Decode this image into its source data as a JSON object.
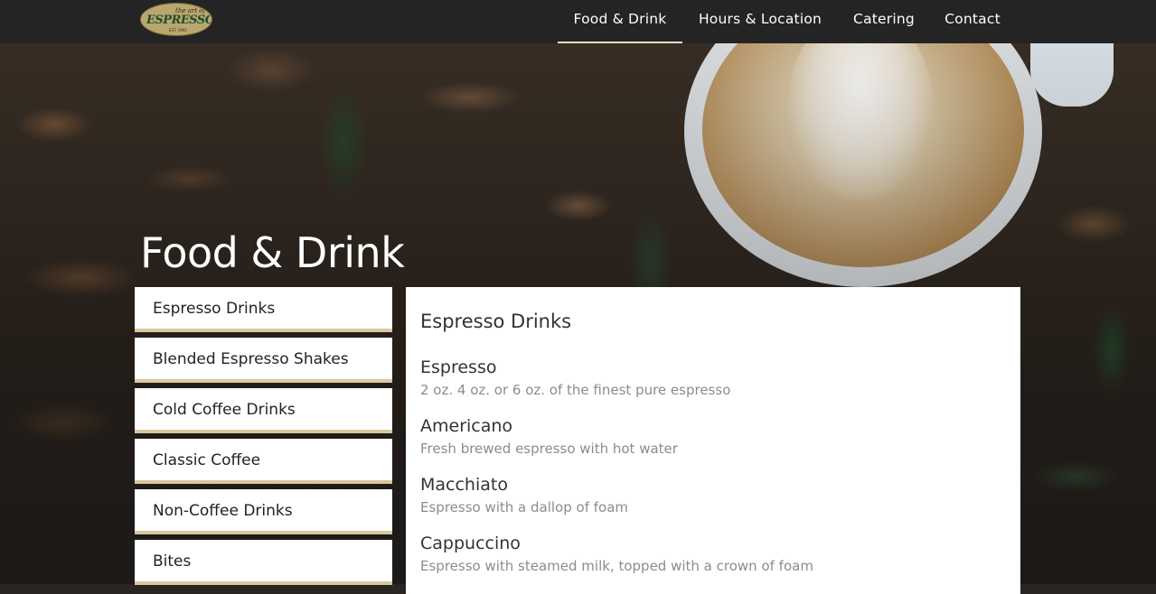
{
  "header": {
    "logo": {
      "small_text": "the art of",
      "main_text": "ESPRESSO",
      "est_text": "EST. 1995"
    },
    "nav": [
      {
        "label": "Food & Drink",
        "active": true
      },
      {
        "label": "Hours & Location",
        "active": false
      },
      {
        "label": "Catering",
        "active": false
      },
      {
        "label": "Contact",
        "active": false
      }
    ]
  },
  "hero": {
    "title": "Food & Drink"
  },
  "side_menu": {
    "items": [
      "Espresso Drinks",
      "Blended Espresso Shakes",
      "Cold Coffee Drinks",
      "Classic Coffee",
      "Non-Coffee Drinks",
      "Bites"
    ]
  },
  "panel": {
    "title": "Espresso Drinks",
    "items": [
      {
        "name": "Espresso",
        "desc": "2 oz. 4 oz. or 6 oz. of the finest pure espresso"
      },
      {
        "name": "Americano",
        "desc": "Fresh brewed espresso with hot water"
      },
      {
        "name": "Macchiato",
        "desc": "Espresso with a dallop of foam"
      },
      {
        "name": "Cappuccino",
        "desc": "Espresso with steamed milk, topped with a crown of foam"
      }
    ]
  },
  "colors": {
    "header_bg": "#242424",
    "active_underline": "#e8dcc0",
    "menu_border": "#d8c7a0"
  }
}
